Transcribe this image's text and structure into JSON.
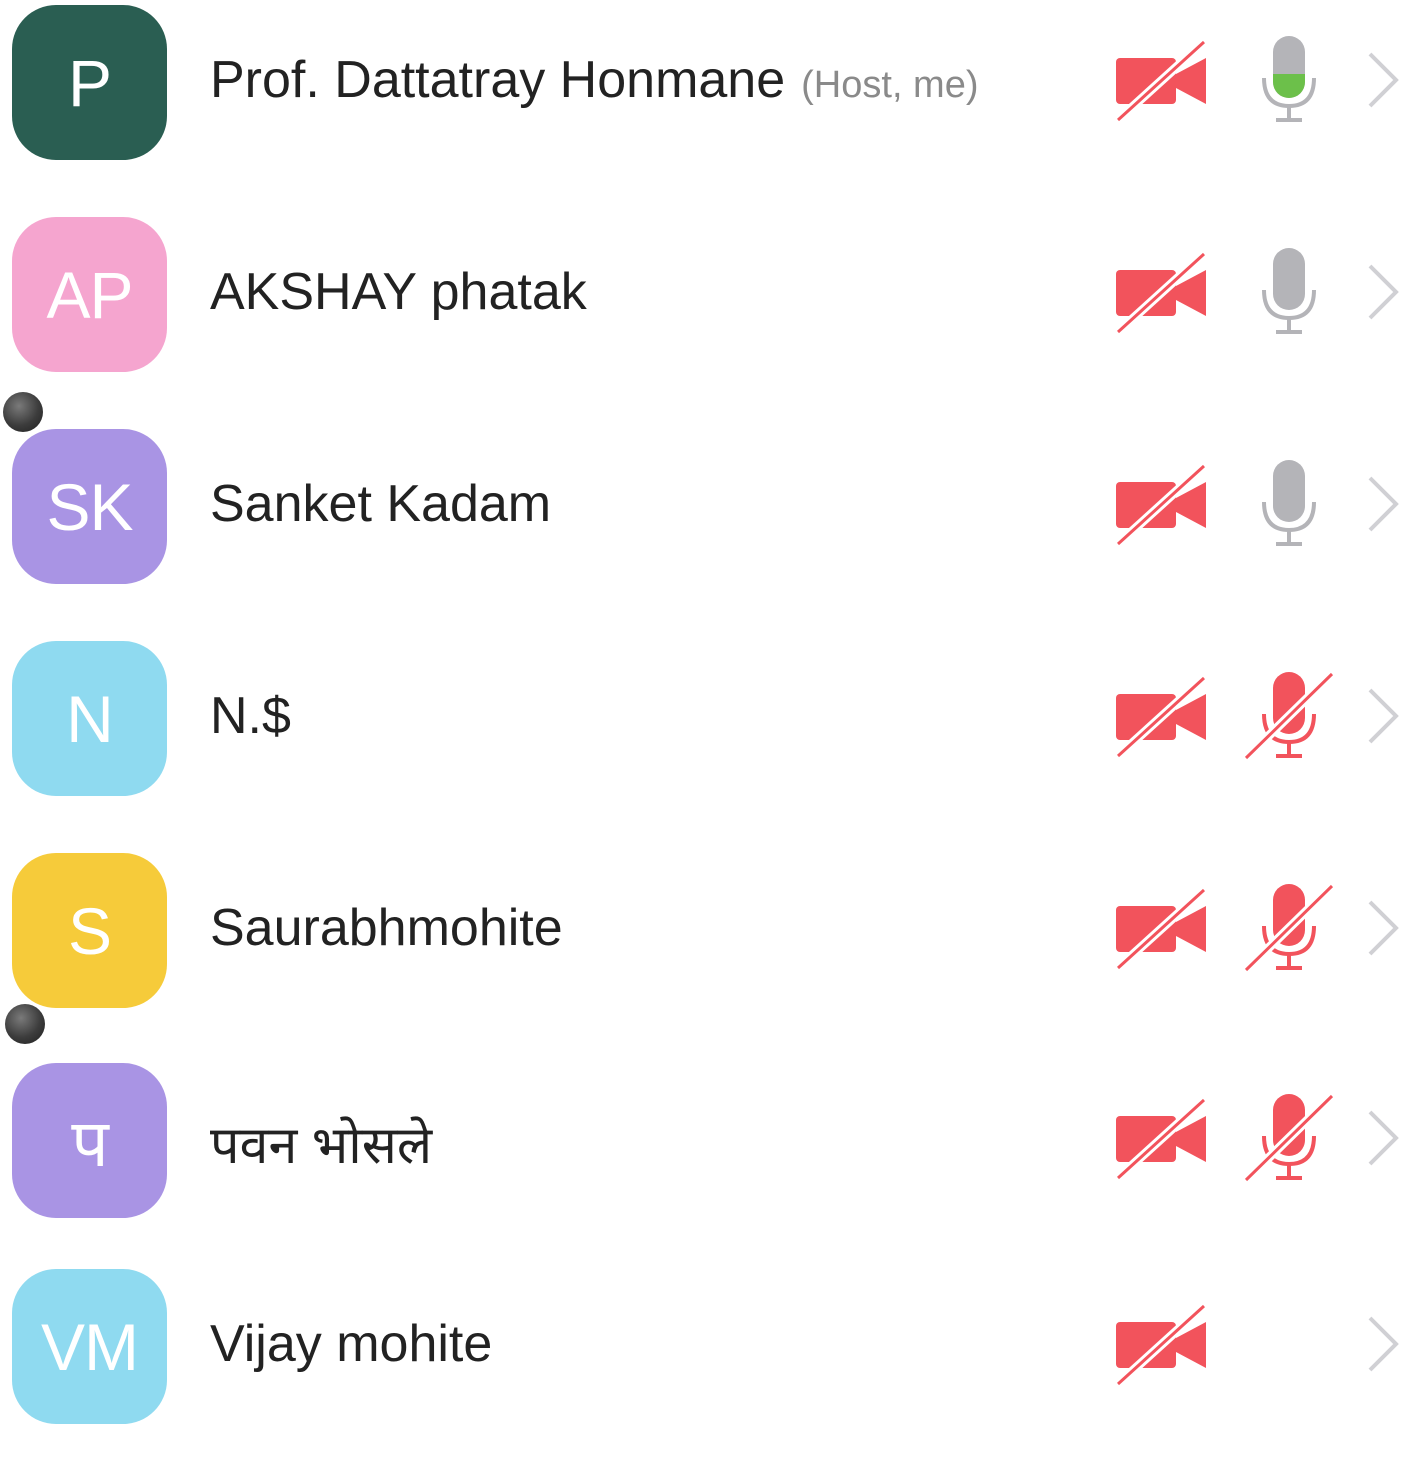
{
  "participants": [
    {
      "initials": "P",
      "name": "Prof. Dattatray Honmane",
      "tag": "(Host, me)",
      "avatar_color": "#2a5e52",
      "video": "off",
      "mic": "on-active"
    },
    {
      "initials": "AP",
      "name": "AKSHAY phatak",
      "tag": "",
      "avatar_color": "#f5a5cf",
      "video": "off",
      "mic": "on"
    },
    {
      "initials": "SK",
      "name": "Sanket Kadam",
      "tag": "",
      "avatar_color": "#a994e4",
      "video": "off",
      "mic": "on"
    },
    {
      "initials": "N",
      "name": "N.$",
      "tag": "",
      "avatar_color": "#8fdaf0",
      "video": "off",
      "mic": "muted"
    },
    {
      "initials": "S",
      "name": "Saurabhmohite",
      "tag": "",
      "avatar_color": "#f6cb3a",
      "video": "off",
      "mic": "muted"
    },
    {
      "initials": "प",
      "name": "पवन भोसले",
      "tag": "",
      "avatar_color": "#a994e4",
      "video": "off",
      "mic": "muted"
    },
    {
      "initials": "VM",
      "name": "Vijay mohite",
      "tag": "",
      "avatar_color": "#8fdaf0",
      "video": "off",
      "mic": "none"
    }
  ],
  "colors": {
    "muted_red": "#f2535c",
    "mic_gray": "#b4b4b8",
    "mic_active_green": "#6cc04a",
    "chevron_gray": "#d0d0d4"
  }
}
